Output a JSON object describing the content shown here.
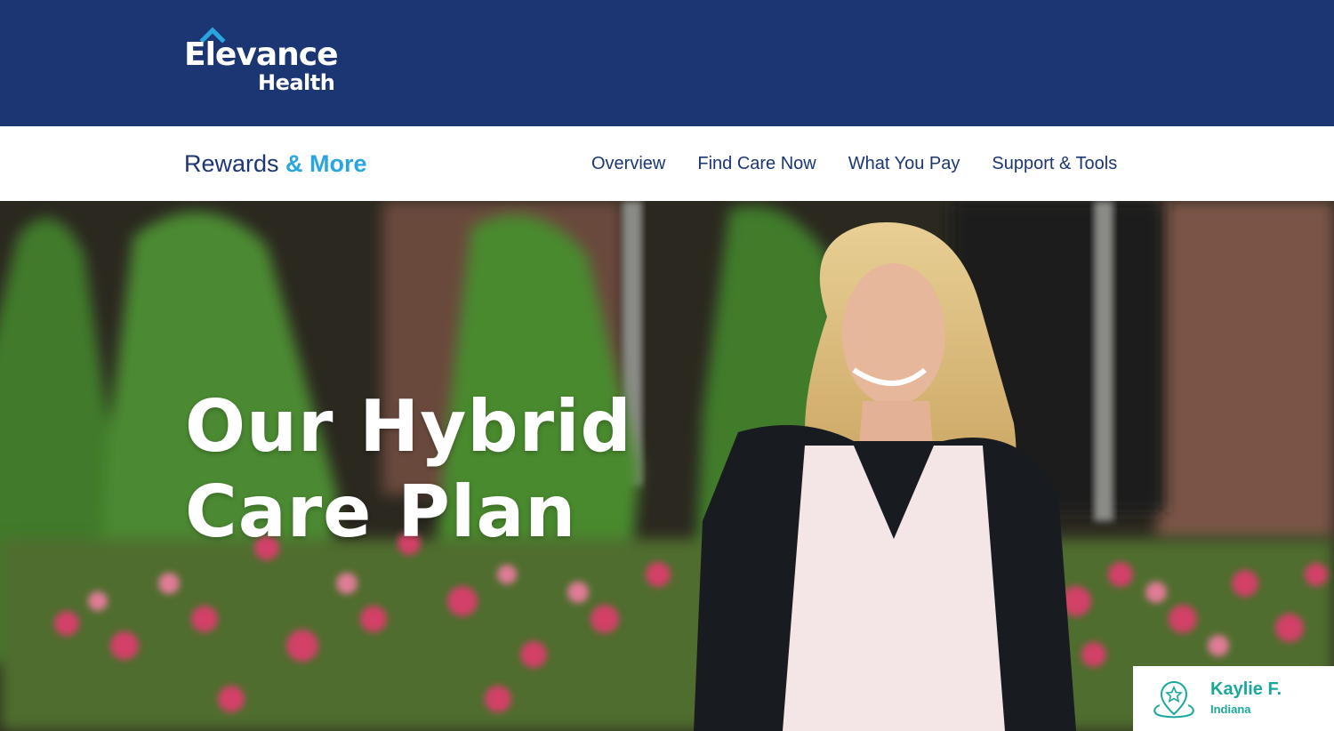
{
  "brand": {
    "logo_line1": "Elevance",
    "logo_line2": "Health",
    "logo_tm": "™"
  },
  "sub_nav": {
    "program_part1": "Rewards ",
    "program_part2": "& More",
    "links": [
      {
        "label": "Overview"
      },
      {
        "label": "Find Care Now"
      },
      {
        "label": "What You Pay"
      },
      {
        "label": "Support & Tools"
      }
    ]
  },
  "hero": {
    "heading_line1": "Our Hybrid",
    "heading_line2": "Care Plan"
  },
  "member": {
    "name": "Kaylie F.",
    "state": "Indiana",
    "icon": "location-star-icon"
  },
  "colors": {
    "brand_navy": "#1c3674",
    "accent_blue": "#2aa5df",
    "teal": "#1aa89a"
  }
}
